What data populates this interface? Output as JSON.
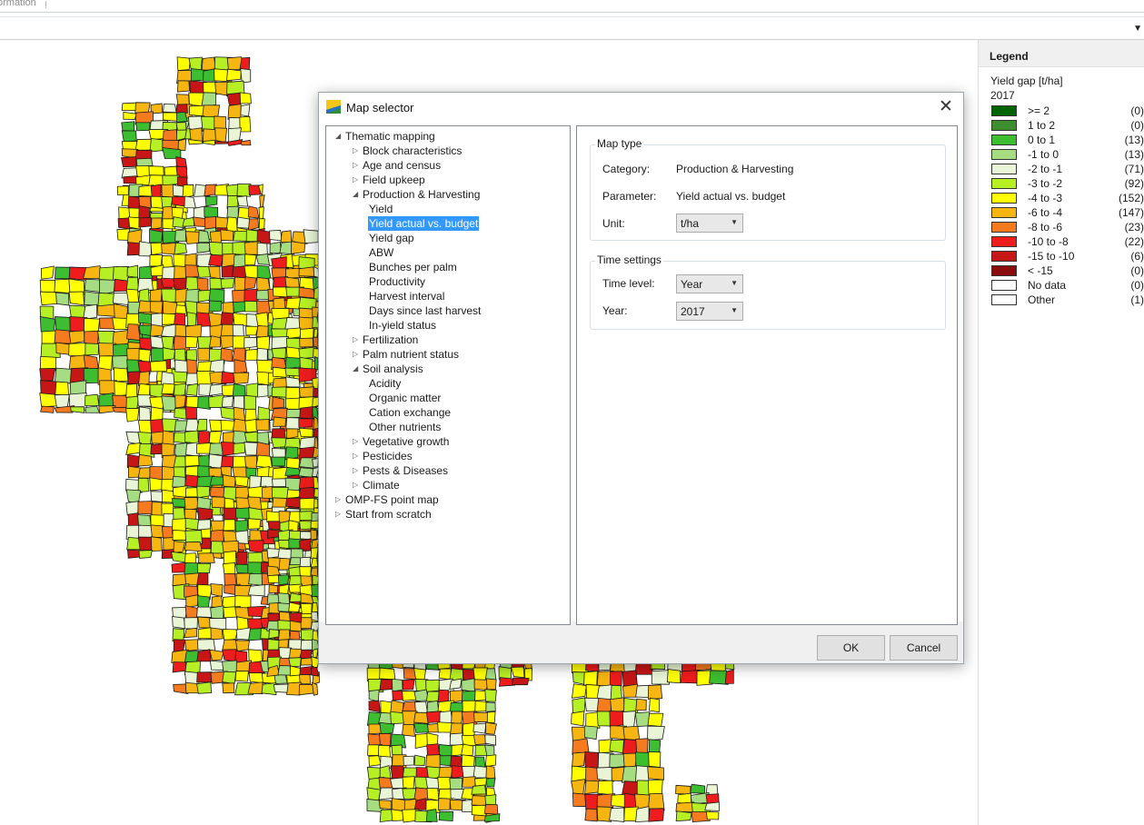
{
  "tab_strip": {
    "text": "ormation"
  },
  "legend": {
    "header": "Legend",
    "title": "Yield gap [t/ha]",
    "year": "2017",
    "items": [
      {
        "label": ">= 2",
        "count": "(0)",
        "color": "#006400"
      },
      {
        "label": "1 to 2",
        "count": "(0)",
        "color": "#3e8e2f"
      },
      {
        "label": "0 to 1",
        "count": "(13)",
        "color": "#3dbd30"
      },
      {
        "label": "-1 to 0",
        "count": "(13)",
        "color": "#a6dd83"
      },
      {
        "label": "-2 to -1",
        "count": "(71)",
        "color": "#e9f5d6"
      },
      {
        "label": "-3 to -2",
        "count": "(92)",
        "color": "#b6ef24"
      },
      {
        "label": "-4 to -3",
        "count": "(152)",
        "color": "#ffff00"
      },
      {
        "label": "-6 to -4",
        "count": "(147)",
        "color": "#f6b510"
      },
      {
        "label": "-8 to -6",
        "count": "(23)",
        "color": "#f67a1e"
      },
      {
        "label": "-10 to -8",
        "count": "(22)",
        "color": "#ee1c1c"
      },
      {
        "label": "-15 to -10",
        "count": "(6)",
        "color": "#c71616"
      },
      {
        "label": "< -15",
        "count": "(0)",
        "color": "#8a0d0d"
      },
      {
        "label": "No data",
        "count": "(0)",
        "color": "#ffffff"
      },
      {
        "label": "Other",
        "count": "(1)",
        "color": "#ffffff"
      }
    ]
  },
  "dialog": {
    "title": "Map selector",
    "icon": "map-flag-icon",
    "close_icon": "close-icon",
    "tree": [
      {
        "label": "Thematic mapping",
        "level": 0,
        "state": "expanded"
      },
      {
        "label": "Block characteristics",
        "level": 1,
        "state": "collapsed"
      },
      {
        "label": "Age and census",
        "level": 1,
        "state": "collapsed"
      },
      {
        "label": "Field upkeep",
        "level": 1,
        "state": "collapsed"
      },
      {
        "label": "Production & Harvesting",
        "level": 1,
        "state": "expanded"
      },
      {
        "label": "Yield",
        "level": 2,
        "state": "leaf"
      },
      {
        "label": "Yield actual vs. budget",
        "level": 2,
        "state": "leaf",
        "selected": true
      },
      {
        "label": "Yield gap",
        "level": 2,
        "state": "leaf"
      },
      {
        "label": "ABW",
        "level": 2,
        "state": "leaf"
      },
      {
        "label": "Bunches per palm",
        "level": 2,
        "state": "leaf"
      },
      {
        "label": "Productivity",
        "level": 2,
        "state": "leaf"
      },
      {
        "label": "Harvest interval",
        "level": 2,
        "state": "leaf"
      },
      {
        "label": "Days since last harvest",
        "level": 2,
        "state": "leaf"
      },
      {
        "label": "In-yield status",
        "level": 2,
        "state": "leaf"
      },
      {
        "label": "Fertilization",
        "level": 1,
        "state": "collapsed"
      },
      {
        "label": "Palm nutrient status",
        "level": 1,
        "state": "collapsed"
      },
      {
        "label": "Soil analysis",
        "level": 1,
        "state": "expanded"
      },
      {
        "label": "Acidity",
        "level": 2,
        "state": "leaf"
      },
      {
        "label": "Organic matter",
        "level": 2,
        "state": "leaf"
      },
      {
        "label": "Cation exchange",
        "level": 2,
        "state": "leaf"
      },
      {
        "label": "Other nutrients",
        "level": 2,
        "state": "leaf"
      },
      {
        "label": "Vegetative growth",
        "level": 1,
        "state": "collapsed"
      },
      {
        "label": "Pesticides",
        "level": 1,
        "state": "collapsed"
      },
      {
        "label": "Pests & Diseases",
        "level": 1,
        "state": "collapsed"
      },
      {
        "label": "Climate",
        "level": 1,
        "state": "collapsed"
      },
      {
        "label": "OMP-FS point map",
        "level": 0,
        "state": "collapsed"
      },
      {
        "label": "Start from scratch",
        "level": 0,
        "state": "collapsed"
      }
    ],
    "map_type": {
      "group_title": "Map type",
      "category_label": "Category:",
      "category_value": "Production & Harvesting",
      "parameter_label": "Parameter:",
      "parameter_value": "Yield actual vs. budget",
      "unit_label": "Unit:",
      "unit_value": "t/ha"
    },
    "time_settings": {
      "group_title": "Time settings",
      "time_level_label": "Time level:",
      "time_level_value": "Year",
      "year_label": "Year:",
      "year_value": "2017"
    },
    "ok_label": "OK",
    "cancel_label": "Cancel"
  }
}
